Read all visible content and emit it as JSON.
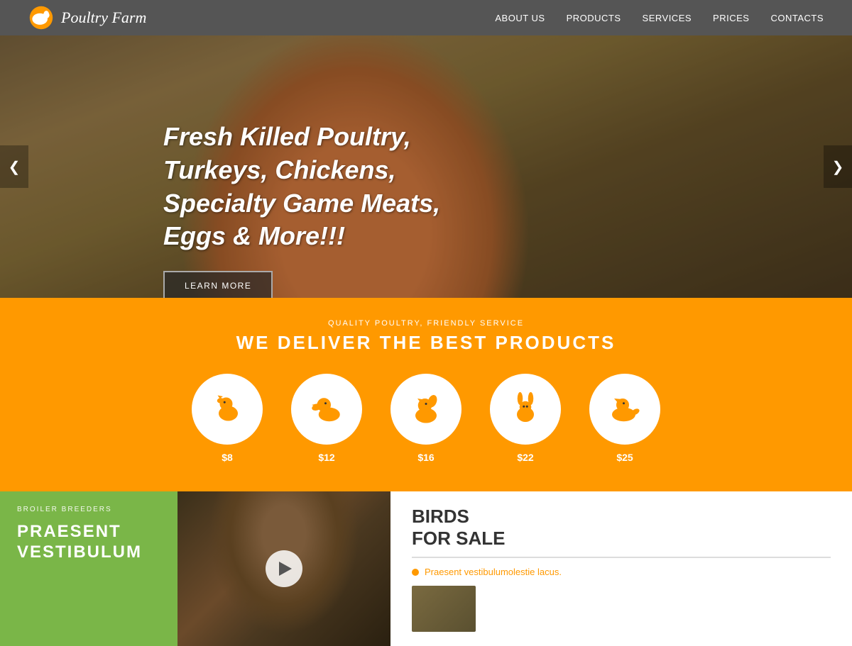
{
  "header": {
    "logo_text": "Poultry Farm",
    "nav": [
      {
        "label": "ABOUT US",
        "id": "about"
      },
      {
        "label": "PRODUCTS",
        "id": "products"
      },
      {
        "label": "SERVICES",
        "id": "services"
      },
      {
        "label": "PRICES",
        "id": "prices"
      },
      {
        "label": "CONTACTS",
        "id": "contacts"
      }
    ]
  },
  "hero": {
    "title": "Fresh Killed Poultry, Turkeys, Chickens, Specialty Game Meats, Eggs & More!!!",
    "button_label": "LEARN MORE",
    "arrow_left": "❮",
    "arrow_right": "❯"
  },
  "products_band": {
    "subtitle": "QUALITY POULTRY, FRIENDLY SERVICE",
    "title": "WE DELIVER THE BEST PRODUCTS",
    "items": [
      {
        "icon": "🐔",
        "price": "$8"
      },
      {
        "icon": "🦆",
        "price": "$12"
      },
      {
        "icon": "🦅",
        "price": "$16"
      },
      {
        "icon": "🐇",
        "price": "$22"
      },
      {
        "icon": "🐓",
        "price": "$25"
      }
    ]
  },
  "bottom": {
    "green": {
      "label": "BROILER BREEDERS",
      "big_text": "PRAESENT\nVESTIBULUM"
    },
    "birds_title_line1": "BIRDS",
    "birds_title_line2": "FOR SALE",
    "birds_link_text": "Praesent vestibulumolestie lacus."
  }
}
